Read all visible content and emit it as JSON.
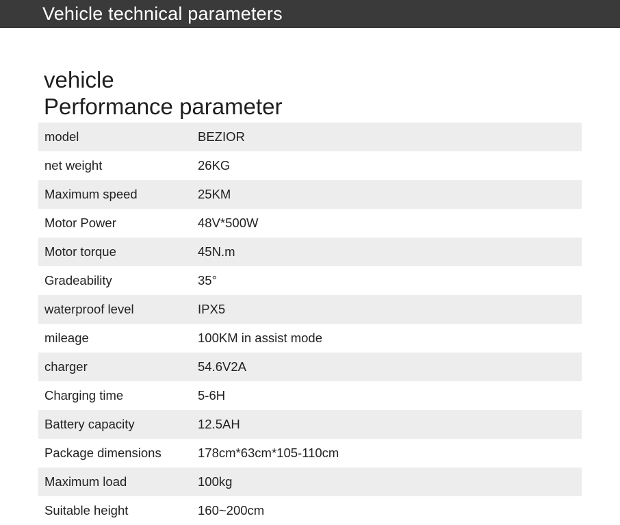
{
  "banner": {
    "title": "Vehicle technical parameters"
  },
  "section": {
    "heading_line1": "vehicle",
    "heading_line2": "Performance parameter"
  },
  "specs": [
    {
      "label": "model",
      "value": "BEZIOR"
    },
    {
      "label": "net weight",
      "value": "26KG"
    },
    {
      "label": "Maximum speed",
      "value": "25KM"
    },
    {
      "label": "Motor Power",
      "value": "48V*500W"
    },
    {
      "label": "Motor torque",
      "value": "45N.m"
    },
    {
      "label": "Gradeability",
      "value": "35°"
    },
    {
      "label": "waterproof level",
      "value": "IPX5"
    },
    {
      "label": "mileage",
      "value": "100KM in assist mode"
    },
    {
      "label": "charger",
      "value": "54.6V2A"
    },
    {
      "label": "Charging time",
      "value": "5-6H"
    },
    {
      "label": "Battery capacity",
      "value": "12.5AH"
    },
    {
      "label": "Package dimensions",
      "value": "178cm*63cm*105-110cm"
    },
    {
      "label": "Maximum load",
      "value": "100kg"
    },
    {
      "label": "Suitable height",
      "value": "160~200cm"
    }
  ],
  "colors": {
    "banner_bg": "#3a3a3a",
    "row_shade": "#ededed",
    "text": "#222222"
  }
}
